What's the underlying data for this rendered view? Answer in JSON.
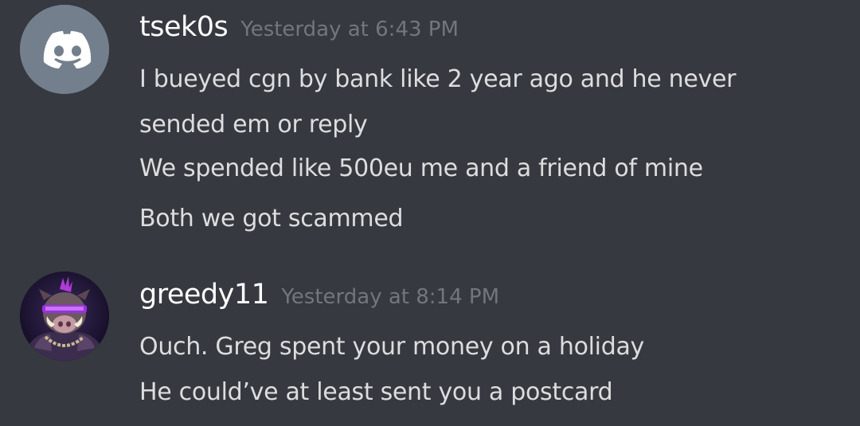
{
  "messages": [
    {
      "username": "tsek0s",
      "timestamp": "Yesterday at 6:43 PM",
      "avatar_icon": "discord-default-avatar-icon",
      "avatar_color": "#747f8d",
      "lines": [
        "I bueyed cgn by bank like 2 year ago and he never",
        "sended em or reply",
        "We spended like 500eu me and a friend of mine",
        "Both we got scammed"
      ]
    },
    {
      "username": "greedy11",
      "timestamp": "Yesterday at 8:14 PM",
      "avatar_icon": "warthog-character-avatar-icon",
      "lines": [
        "Ouch. Greg spent your money on a holiday",
        "He could’ve at least sent you a postcard"
      ]
    }
  ],
  "colors": {
    "background": "#36393f",
    "username": "#ffffff",
    "timestamp": "#72767d",
    "message_text": "#dcddde"
  }
}
